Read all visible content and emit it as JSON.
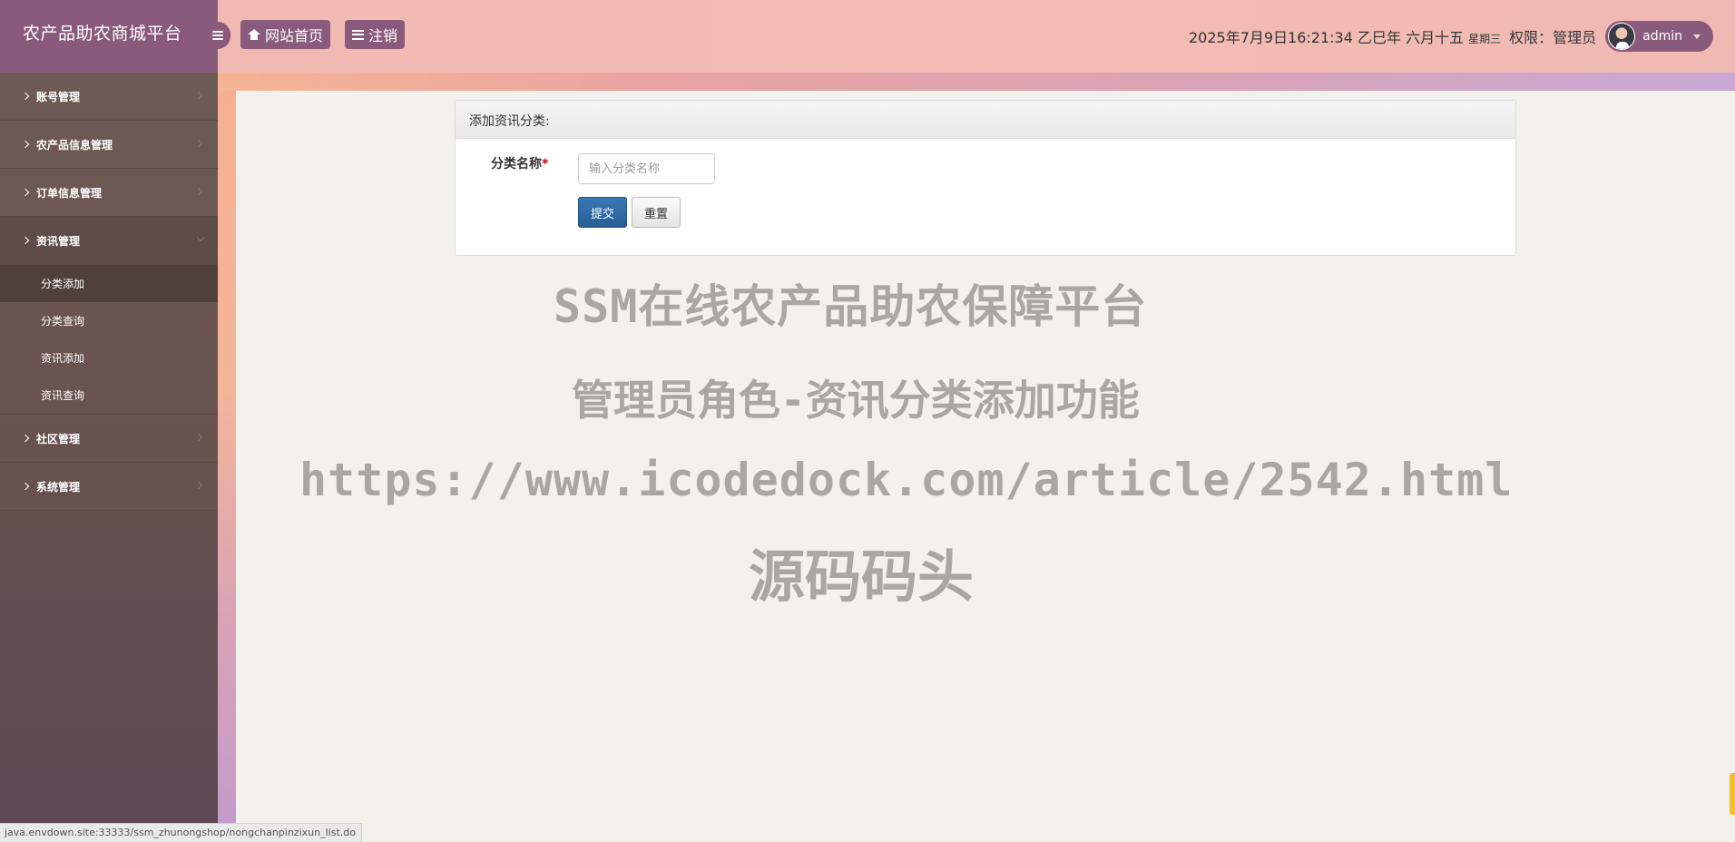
{
  "header": {
    "brand": "农产品助农商城平台",
    "home_label": "网站首页",
    "logout_label": "注销",
    "datetime": "2025年7月9日16:21:34 乙巳年 六月十五",
    "weekday": "星期三",
    "role": "权限：管理员",
    "username": "admin"
  },
  "sidebar": {
    "items": [
      {
        "label": "账号管理"
      },
      {
        "label": "农产品信息管理"
      },
      {
        "label": "订单信息管理"
      },
      {
        "label": "资讯管理"
      },
      {
        "label": "社区管理"
      },
      {
        "label": "系统管理"
      }
    ],
    "submenu": [
      {
        "label": "分类添加"
      },
      {
        "label": "分类查询"
      },
      {
        "label": "资讯添加"
      },
      {
        "label": "资讯查询"
      }
    ]
  },
  "panel": {
    "title": "添加资讯分类:",
    "field_label": "分类名称",
    "required_mark": "*",
    "field_placeholder": "输入分类名称",
    "field_value": "",
    "submit_label": "提交",
    "reset_label": "重置"
  },
  "watermark": {
    "line1": "SSM在线农产品助农保障平台",
    "line2": "管理员角色-资讯分类添加功能",
    "line3": "https://www.icodedock.com/article/2542.html",
    "line4": "源码码头"
  },
  "statusbar": {
    "url": "java.envdown.site:33333/ssm_zhunongshop/nongchanpinzixun_list.do"
  },
  "icons": {
    "toggle": "hamburger-icon",
    "home": "home-icon",
    "logout": "bars-icon",
    "dropdown": "caret-down-icon"
  },
  "colors": {
    "accent": "#8a5a7d",
    "header_bg": "#f2bcb4",
    "sidebar_bg": "#67524f",
    "primary_button": "#2f6ca8"
  }
}
